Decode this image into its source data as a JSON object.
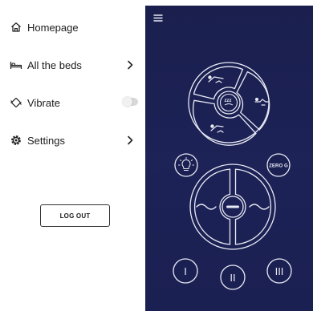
{
  "menu": {
    "items": [
      {
        "label": "Homepage",
        "icon": "home-icon"
      },
      {
        "label": "All the beds",
        "icon": "bed-icon",
        "trailing": "chevron-right-icon"
      },
      {
        "label": "Vibrate",
        "icon": "vibrate-icon",
        "trailing": "toggle",
        "toggle_on": false
      },
      {
        "label": "Settings",
        "icon": "gear-icon",
        "trailing": "chevron-right-icon"
      }
    ],
    "logout_label": "LOG OUT"
  },
  "remote": {
    "zero_g_label": "ZERO G",
    "preset_1_label": "I",
    "preset_2_label": "II",
    "preset_3_label": "III",
    "colors": {
      "background": "#1b2052",
      "stroke": "#e8eaf4"
    }
  }
}
